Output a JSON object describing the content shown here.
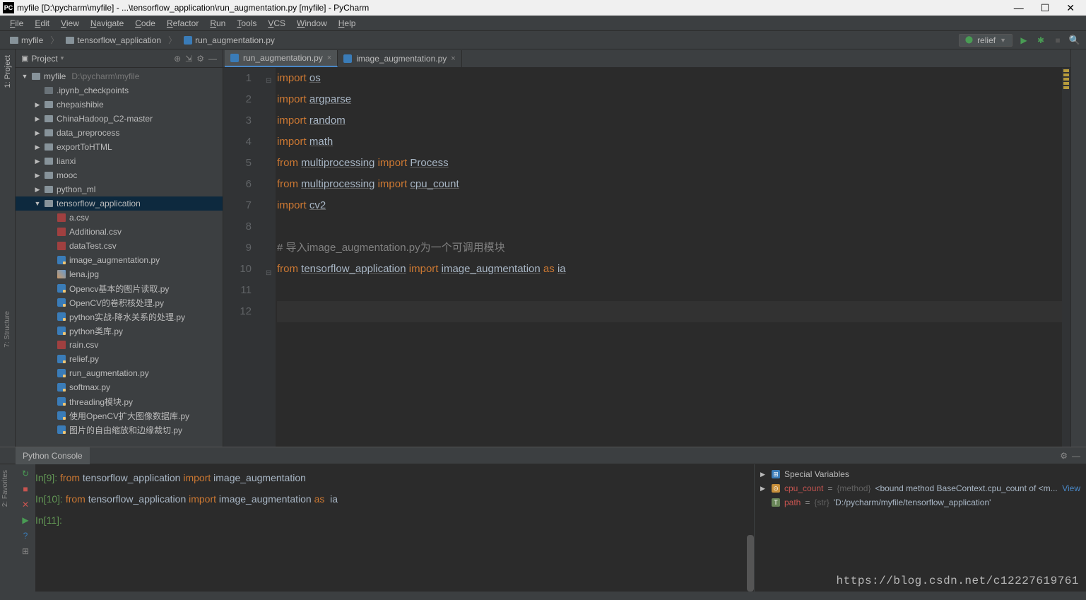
{
  "window": {
    "title": "myfile [D:\\pycharm\\myfile] - ...\\tensorflow_application\\run_augmentation.py [myfile] - PyCharm"
  },
  "menu": [
    "File",
    "Edit",
    "View",
    "Navigate",
    "Code",
    "Refactor",
    "Run",
    "Tools",
    "VCS",
    "Window",
    "Help"
  ],
  "breadcrumb": [
    {
      "icon": "folder",
      "label": "myfile"
    },
    {
      "icon": "folder",
      "label": "tensorflow_application"
    },
    {
      "icon": "py",
      "label": "run_augmentation.py"
    }
  ],
  "run_config": "relief",
  "project_panel": {
    "title": "Project",
    "tree": [
      {
        "depth": 0,
        "arrow": "▼",
        "icon": "folder",
        "name": "myfile",
        "hint": "D:\\pycharm\\myfile"
      },
      {
        "depth": 1,
        "arrow": "",
        "icon": "folder-dark",
        "name": ".ipynb_checkpoints"
      },
      {
        "depth": 1,
        "arrow": "▶",
        "icon": "folder",
        "name": "chepaishibie"
      },
      {
        "depth": 1,
        "arrow": "▶",
        "icon": "folder",
        "name": "ChinaHadoop_C2-master"
      },
      {
        "depth": 1,
        "arrow": "▶",
        "icon": "folder",
        "name": "data_preprocess"
      },
      {
        "depth": 1,
        "arrow": "▶",
        "icon": "folder",
        "name": "exportToHTML"
      },
      {
        "depth": 1,
        "arrow": "▶",
        "icon": "folder",
        "name": "lianxi"
      },
      {
        "depth": 1,
        "arrow": "▶",
        "icon": "folder",
        "name": "mooc"
      },
      {
        "depth": 1,
        "arrow": "▶",
        "icon": "folder",
        "name": "python_ml"
      },
      {
        "depth": 1,
        "arrow": "▼",
        "icon": "folder",
        "name": "tensorflow_application",
        "selected": true
      },
      {
        "depth": 2,
        "arrow": "",
        "icon": "csv",
        "name": "a.csv"
      },
      {
        "depth": 2,
        "arrow": "",
        "icon": "csv",
        "name": "Additional.csv"
      },
      {
        "depth": 2,
        "arrow": "",
        "icon": "csv",
        "name": "dataTest.csv"
      },
      {
        "depth": 2,
        "arrow": "",
        "icon": "py",
        "name": "image_augmentation.py"
      },
      {
        "depth": 2,
        "arrow": "",
        "icon": "img",
        "name": "lena.jpg"
      },
      {
        "depth": 2,
        "arrow": "",
        "icon": "py",
        "name": "Opencv基本的图片读取.py"
      },
      {
        "depth": 2,
        "arrow": "",
        "icon": "py",
        "name": "OpenCV的卷积核处理.py"
      },
      {
        "depth": 2,
        "arrow": "",
        "icon": "py",
        "name": "python实战-降水关系的处理.py"
      },
      {
        "depth": 2,
        "arrow": "",
        "icon": "py",
        "name": "python类库.py"
      },
      {
        "depth": 2,
        "arrow": "",
        "icon": "csv",
        "name": "rain.csv"
      },
      {
        "depth": 2,
        "arrow": "",
        "icon": "py",
        "name": "relief.py"
      },
      {
        "depth": 2,
        "arrow": "",
        "icon": "py",
        "name": "run_augmentation.py"
      },
      {
        "depth": 2,
        "arrow": "",
        "icon": "py",
        "name": "softmax.py"
      },
      {
        "depth": 2,
        "arrow": "",
        "icon": "py",
        "name": "threading模块.py"
      },
      {
        "depth": 2,
        "arrow": "",
        "icon": "py",
        "name": "使用OpenCV扩大图像数据库.py"
      },
      {
        "depth": 2,
        "arrow": "",
        "icon": "py",
        "name": "图片的自由缩放和边缘裁切.py"
      }
    ]
  },
  "editor": {
    "tabs": [
      {
        "name": "run_augmentation.py",
        "active": true
      },
      {
        "name": "image_augmentation.py",
        "active": false
      }
    ],
    "lines": [
      {
        "n": 1,
        "html": "<span class='kw'>import</span> <span class='und'>os</span>"
      },
      {
        "n": 2,
        "html": "<span class='kw'>import</span> <span class='und'>argparse</span>"
      },
      {
        "n": 3,
        "html": "<span class='kw'>import</span> <span class='und'>random</span>"
      },
      {
        "n": 4,
        "html": "<span class='kw'>import</span> <span class='und'>math</span>"
      },
      {
        "n": 5,
        "html": "<span class='kw'>from</span> <span class='und'>multiprocessing</span> <span class='kw'>import</span> <span class='und'>Process</span>"
      },
      {
        "n": 6,
        "html": "<span class='kw'>from</span> <span class='und'>multiprocessing</span> <span class='kw'>import</span> <span class='und'>cpu_count</span>"
      },
      {
        "n": 7,
        "html": "<span class='kw'>import</span> <span class='und'>cv2</span>"
      },
      {
        "n": 8,
        "html": ""
      },
      {
        "n": 9,
        "html": "<span class='cmt'># 导入image_augmentation.py为一个可调用模块</span>"
      },
      {
        "n": 10,
        "html": "<span class='kw'>from</span> <span class='und'>tensorflow_application</span> <span class='kw'>import</span> <span class='und'>image_augmentation</span> <span class='kw'>as</span> <span class='und'>ia</span>"
      },
      {
        "n": 11,
        "html": ""
      },
      {
        "n": 12,
        "html": "",
        "caret": true
      }
    ]
  },
  "left_tabs": [
    "1: Project",
    "7: Structure",
    "2: Favorites"
  ],
  "console": {
    "tab": "Python Console",
    "lines": [
      {
        "prompt": "In[9]: ",
        "body": "<span class='c-kw'>from</span> <span class='c-txt'>tensorflow_application </span><span class='c-kw'>import</span> <span class='c-txt'>image_augmentation</span>"
      },
      {
        "prompt": "In[10]: ",
        "body": "<span class='c-kw'>from</span> <span class='c-txt'>tensorflow_application </span><span class='c-kw'>import</span> <span class='c-txt'>image_augmentation </span><span class='c-kw'>as</span> <span class='c-txt'> ia</span>"
      },
      {
        "prompt": "",
        "body": ""
      },
      {
        "prompt": "In[11]: ",
        "body": ""
      }
    ],
    "vars": [
      {
        "arrow": "▶",
        "ic": "blue",
        "name": "Special Variables"
      },
      {
        "arrow": "▶",
        "ic": "orange",
        "varname": "cpu_count",
        "type": "{method}",
        "val": "<bound method BaseContext.cpu_count of <m...",
        "link": "View"
      },
      {
        "arrow": "",
        "ic": "text",
        "varname": "path",
        "type": "{str}",
        "val": "'D:/pycharm/myfile/tensorflow_application'"
      }
    ]
  },
  "watermark": "https://blog.csdn.net/c12227619761"
}
